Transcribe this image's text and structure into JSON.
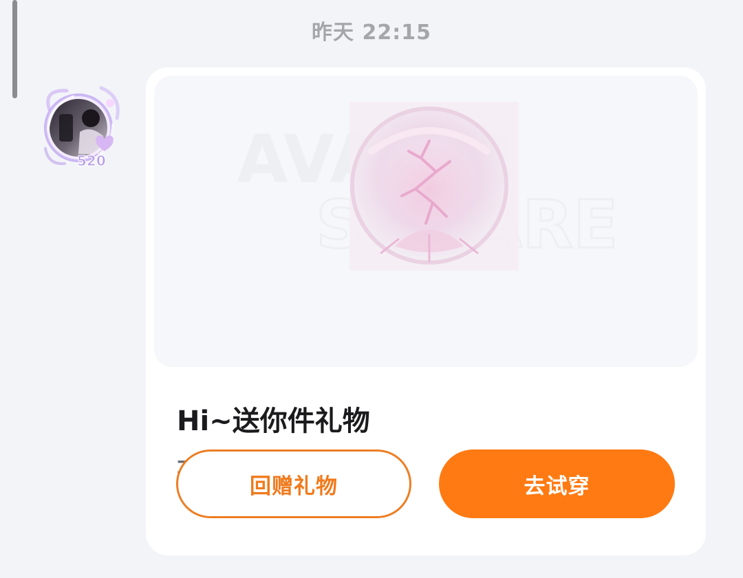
{
  "message": {
    "timestamp": "昨天 22:15",
    "avatar_badge": "520"
  },
  "gift_card": {
    "banner_watermark_line1": "AVATAR",
    "banner_watermark_line2": "SQUARE",
    "title": "Hi~送你件礼物",
    "subtitle": "不了",
    "return_gift_label": "回赠礼物",
    "try_on_label": "去试穿"
  },
  "colors": {
    "accent": "#ff7a12",
    "accent_outline": "#ec7e23",
    "background": "#f3f4f8"
  }
}
